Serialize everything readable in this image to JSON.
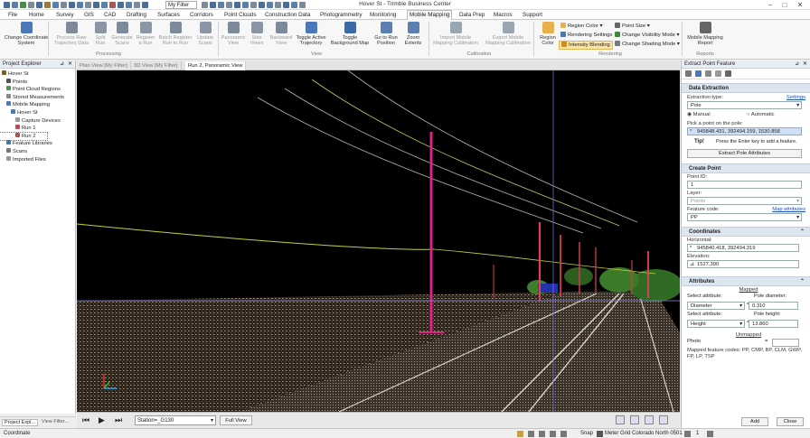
{
  "title_bar": {
    "app_title": "Hover St - Trimble Business Center",
    "filter_value": "My Filter"
  },
  "menu_tabs": [
    "File",
    "Home",
    "Survey",
    "GIS",
    "CAD",
    "Drafting",
    "Surfaces",
    "Corridors",
    "Point Clouds",
    "Construction Data",
    "Photogrammetry",
    "Monitoring",
    "Mobile Mapping",
    "Data Prep",
    "Macros",
    "Support"
  ],
  "active_menu_tab": "Mobile Mapping",
  "ribbon": {
    "buttons": [
      {
        "label1": "Change Coordinate",
        "label2": "System",
        "dim": false
      },
      {
        "label1": "Process Raw",
        "label2": "Trajectory Data",
        "dim": true
      },
      {
        "label1": "Split",
        "label2": "Run",
        "dim": true
      },
      {
        "label1": "Generate",
        "label2": "Scans",
        "dim": true
      },
      {
        "label1": "Register",
        "label2": "a Run",
        "dim": true
      },
      {
        "label1": "Batch Register",
        "label2": "Run to Run",
        "dim": true
      },
      {
        "label1": "Update",
        "label2": "Scans",
        "dim": true
      },
      {
        "label1": "Panoramic",
        "label2": "View",
        "dim": true
      },
      {
        "label1": "Side",
        "label2": "Views",
        "dim": true
      },
      {
        "label1": "Backward",
        "label2": "View",
        "dim": true
      },
      {
        "label1": "Toggle Active",
        "label2": "Trajectory",
        "dim": false
      },
      {
        "label1": "Toggle",
        "label2": "Background Map",
        "dim": false
      },
      {
        "label1": "Go to Run",
        "label2": "Position",
        "dim": false
      },
      {
        "label1": "Zoom",
        "label2": "Extents",
        "dim": false
      },
      {
        "label1": "Import Mobile",
        "label2": "Mapping Calibration",
        "dim": true
      },
      {
        "label1": "Export Mobile",
        "label2": "Mapping Calibration",
        "dim": true
      },
      {
        "label1": "Region",
        "label2": "Color",
        "dim": false
      },
      {
        "label1": "Mobile Mapping",
        "label2": "Report",
        "dim": false
      }
    ],
    "groups": [
      "Processing",
      "View",
      "Calibration",
      "Rendering",
      "Reports"
    ],
    "rendering_small": {
      "region_color": "Region Color",
      "rendering_settings": "Rendering Settings",
      "intensity_blending": "Intensity Blending",
      "point_size": "Point Size",
      "change_visibility_mode": "Change Visibility Mode",
      "change_shading_mode": "Change Shading Mode"
    }
  },
  "project_explorer": {
    "title": "Project Explorer",
    "items": [
      {
        "label": "Hover St",
        "indent": 0
      },
      {
        "label": "Points",
        "indent": 1
      },
      {
        "label": "Point Cloud Regions",
        "indent": 1
      },
      {
        "label": "Stored Measurements",
        "indent": 1
      },
      {
        "label": "Mobile Mapping",
        "indent": 1
      },
      {
        "label": "Hover St",
        "indent": 2
      },
      {
        "label": "Capture Devices",
        "indent": 3
      },
      {
        "label": "Run 1",
        "indent": 3
      },
      {
        "label": "Run 2",
        "indent": 3
      },
      {
        "label": "Feature Libraries",
        "indent": 1
      },
      {
        "label": "Scans",
        "indent": 1
      },
      {
        "label": "Imported Files",
        "indent": 1
      }
    ],
    "bottom_tabs": [
      "Project Expl...",
      "View Filter..."
    ]
  },
  "view_tabs": [
    "Plan View [My Filter]",
    "3D View [My Filter]",
    "Run 2, Panoramic View"
  ],
  "active_view_tab": "Run 2, Panoramic View",
  "view_bar": {
    "station_value": "Station=_G130",
    "full_view_label": "Full View"
  },
  "extract_panel": {
    "title": "Extract Point Feature",
    "data_extraction_header": "Data Extraction",
    "extraction_type_label": "Extraction type:",
    "settings_link": "Settings",
    "extraction_type_value": "Pole",
    "manual_label": "Manual",
    "automatic_label": "Automatic",
    "pick_label": "Pick a point on the pole:",
    "pick_value": "945848.431, 392494.159, 1530.858",
    "tip_label": "Tip!",
    "tip_text": "Press the Enter key to add a feature.",
    "extract_pole_btn": "Extract Pole Attributes",
    "create_point_header": "Create Point",
    "point_id_label": "Point ID:",
    "point_id_value": "1",
    "layer_label": "Layer:",
    "layer_value": "Points",
    "feature_code_label": "Feature code:",
    "map_attributes_link": "Map attributes",
    "feature_code_value": "PP",
    "coordinates_header": "Coordinates",
    "horizontal_label": "Horizontal:",
    "horizontal_value": "945840.418, 392494.319",
    "elevation_label": "Elevation:",
    "elevation_value": "1527.390",
    "attributes_header": "Attributes",
    "mapped_label": "Mapped",
    "select_attr_label": "Select attribute:",
    "pole_diameter_label": "Pole diameter:",
    "attr1_value": "Diameter",
    "pole_diameter_value": "0.310",
    "select_attr2_label": "Select attribute:",
    "pole_height_label": "Pole height:",
    "attr2_value": "Height",
    "pole_height_value": "13.860",
    "unmapped_label": "Unmapped",
    "photo_label": "Photo",
    "photo_eq": "=",
    "mapped_codes_text": "Mapped feature codes: PP, CMP, BP, CLM, GWP, FP, LP, TSP",
    "add_button": "Add",
    "close_button": "Close"
  },
  "status_bar": {
    "left_text": "Coordinate",
    "snap": "Snap",
    "meter": "Meter",
    "grid": "Grid",
    "coord_system": "Colorado North 0501",
    "page": "1"
  }
}
